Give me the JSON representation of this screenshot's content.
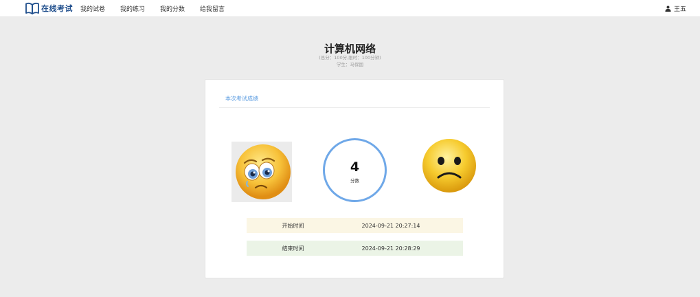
{
  "header": {
    "logo_text": "在线考试",
    "nav": [
      "我的试卷",
      "我的练习",
      "我的分数",
      "给我留言"
    ],
    "user_name": "王五"
  },
  "exam": {
    "title": "计算机网络",
    "meta": "(总分：100分,限时：100分钟)",
    "student": "学生：马保国"
  },
  "result": {
    "card_title": "本次考试成绩",
    "score": "4",
    "score_label": "分数",
    "start_label": "开始时间",
    "start_time": "2024-09-21 20:27:14",
    "end_label": "结束时间",
    "end_time": "2024-09-21 20:28:29"
  },
  "colors": {
    "brand": "#1f4e8c",
    "accent": "#6fa8e8",
    "start_row": "#fbf6e4",
    "end_row": "#ebf4e6"
  },
  "icons": [
    "open-book-icon",
    "user-icon",
    "worried-face-icon",
    "sad-face-icon"
  ]
}
